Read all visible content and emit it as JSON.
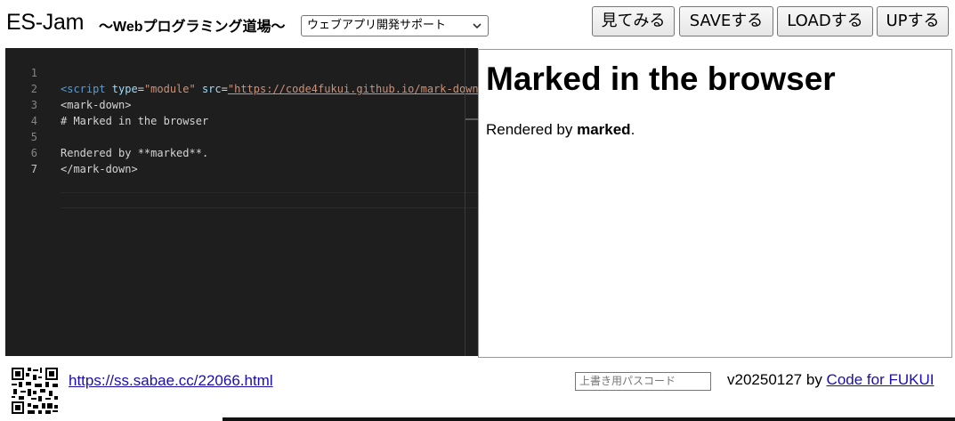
{
  "header": {
    "title": "ES-Jam",
    "subtitle": "〜Webプログラミング道場〜",
    "template_select": "ウェブアプリ開発サポート",
    "buttons": {
      "view": "見てみる",
      "save": "SAVEする",
      "load": "LOADする",
      "up": "UPする"
    }
  },
  "editor": {
    "lines": [
      {
        "num": "1",
        "tag_open": "<script",
        "attr1": " type",
        "eq1": "=",
        "val1": "\"module\"",
        "attr2": " src",
        "eq2": "=",
        "val2": "\"https://code4fukui.github.io/mark-down"
      },
      {
        "num": "2",
        "text": "<mark-down>"
      },
      {
        "num": "3",
        "text": "# Marked in the browser"
      },
      {
        "num": "4",
        "text": ""
      },
      {
        "num": "5",
        "text": "Rendered by **marked**."
      },
      {
        "num": "6",
        "text": "</mark-down>"
      },
      {
        "num": "7",
        "text": ""
      }
    ]
  },
  "preview": {
    "heading": "Marked in the browser",
    "para_prefix": "Rendered by ",
    "para_bold": "marked",
    "para_suffix": "."
  },
  "footer": {
    "share_url": "https://ss.sabae.cc/22066.html",
    "passcode_placeholder": "上書き用パスコード",
    "version_text": "v20250127 by ",
    "credit_link": "Code for FUKUI"
  }
}
